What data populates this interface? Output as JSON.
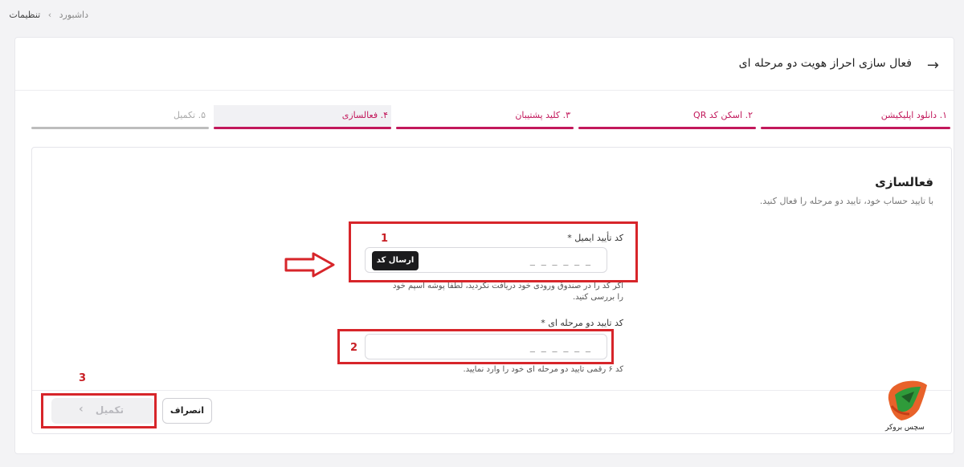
{
  "breadcrumb": {
    "home": "داشبورد",
    "separator": "›",
    "current": "تنظیمات"
  },
  "header": {
    "title": "فعال سازی احراز هویت دو مرحله ای",
    "back_icon": "arrow-right-icon"
  },
  "steps": [
    {
      "label": "۱. دانلود اپلیکیشن",
      "state": "done"
    },
    {
      "label": "۲. اسکن کد QR",
      "state": "done"
    },
    {
      "label": "۳. کلید پشتیبان",
      "state": "done"
    },
    {
      "label": "۴. فعالسازی",
      "state": "active"
    },
    {
      "label": "۵. تکمیل",
      "state": "todo"
    }
  ],
  "section": {
    "title": "فعالسازی",
    "subtitle": "با تایید حساب خود، تایید دو مرحله را فعال کنید."
  },
  "email_code": {
    "label": "کد تأیید ایمیل *",
    "placeholder": "_ _ _ _ _ _",
    "send_button": "ارسال کد",
    "hint_line1": "اگر کد را در صندوق ورودی خود دریافت نکردید، لطفا پوشه اسپم خود",
    "hint_line2": "را بررسی کنید."
  },
  "twofa_code": {
    "label": "کد تایید دو مرحله ای *",
    "placeholder": "_ _ _ _ _ _",
    "hint": "کد ۶ رقمی تایید دو مرحله ای خود را وارد نمایید."
  },
  "buttons": {
    "cancel": "انصراف",
    "finish": "تکمیل"
  },
  "annotations": {
    "one": "1",
    "two": "2",
    "three": "3"
  },
  "logo": {
    "text": "سچس بروکر"
  },
  "colors": {
    "accent": "#c2185b",
    "annotation": "#d7252a"
  }
}
